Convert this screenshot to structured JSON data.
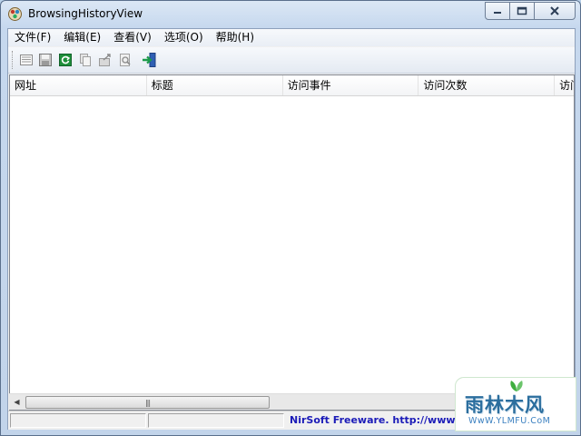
{
  "window": {
    "title": "BrowsingHistoryView"
  },
  "menu": {
    "items": [
      "文件(F)",
      "编辑(E)",
      "查看(V)",
      "选项(O)",
      "帮助(H)"
    ]
  },
  "toolbar": {
    "buttons": [
      "properties-icon",
      "save-icon",
      "refresh-icon",
      "copy-icon",
      "export-icon",
      "find-icon",
      "exit-icon"
    ]
  },
  "list": {
    "columns": [
      "网址",
      "标题",
      "访问事件",
      "访问次数",
      "访问"
    ],
    "rows": []
  },
  "statusbar": {
    "link_text": "NirSoft Freeware.  http://www.nirs"
  },
  "watermark": {
    "title": "雨林木风",
    "subtitle": "WwW.YLMFU.CoM"
  },
  "colors": {
    "accent": "#2b6e9e",
    "link": "#1b1bb8",
    "frame": "#b9d1ea"
  }
}
